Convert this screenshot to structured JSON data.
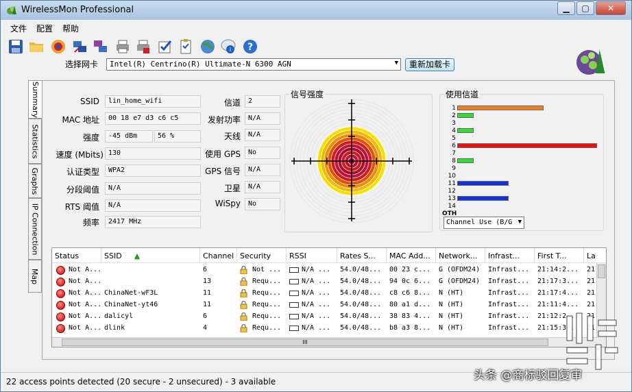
{
  "window": {
    "title": "WirelessMon Professional",
    "min": "▁",
    "max": "▢",
    "close": "✕"
  },
  "menu": [
    "文件",
    "配置",
    "帮助"
  ],
  "toolbar_icons": [
    "save-icon",
    "open-folder-icon",
    "record-icon",
    "network-adapter-icon",
    "network-adapters-icon",
    "printer-icon",
    "print-red-icon",
    "checklist-icon",
    "clipboard-icon",
    "globe-icon",
    "info-chat-icon",
    "help-icon"
  ],
  "nic": {
    "label": "选择网卡",
    "value": "Intel(R) Centrino(R) Ultimate-N 6300 AGN",
    "reload_label": "重新加载卡"
  },
  "tabs": [
    "Summary",
    "Statistics",
    "Graphs",
    "IP Connection",
    "Map"
  ],
  "summary": {
    "left": [
      {
        "label": "SSID",
        "value": "lin_home_wifi"
      },
      {
        "label": "MAC 地址",
        "value": "00 18 e7 d3 c6 c5"
      },
      {
        "label": "强度",
        "value": "-45 dBm",
        "value2": "56 %"
      },
      {
        "label": "速度 (Mbits)",
        "value": "130"
      },
      {
        "label": "认证类型",
        "value": "WPA2"
      },
      {
        "label": "分段阈值",
        "value": "N/A"
      },
      {
        "label": "RTS 阈值",
        "value": "N/A"
      },
      {
        "label": "频率",
        "value": "2417 MHz"
      }
    ],
    "right": [
      {
        "label": "信道",
        "value": "2"
      },
      {
        "label": "发射功率",
        "value": "N/A"
      },
      {
        "label": "天线",
        "value": "N/A"
      },
      {
        "label": "使用 GPS",
        "value": "No"
      },
      {
        "label": "GPS 信号",
        "value": "N/A"
      },
      {
        "label": "卫星",
        "value": "N/A"
      },
      {
        "label": "WiSpy",
        "value": "No"
      }
    ]
  },
  "signal_title": "信号强度",
  "signal_percent": 56,
  "channels": {
    "title": "使用信道",
    "labels": [
      "1",
      "2",
      "3",
      "4",
      "5",
      "6",
      "7",
      "8",
      "9",
      "10",
      "11",
      "12",
      "13",
      "14",
      "OTH"
    ],
    "usage": [
      0.62,
      0.12,
      0,
      0.12,
      0,
      1.0,
      0,
      0.12,
      0,
      0,
      0.37,
      0,
      0.37,
      0,
      0
    ],
    "colors": [
      "#f08020",
      "#30e030",
      "",
      "#30e030",
      "",
      "#ee1010",
      "",
      "#30e030",
      "",
      "",
      "#1030e0",
      "",
      "#1030e0",
      "",
      ""
    ],
    "select_value": "Channel Use (B/G"
  },
  "list": {
    "columns": [
      "Status",
      "SSID",
      "Channel",
      "Security",
      "RSSI",
      "Rates S...",
      "MAC Add...",
      "Network...",
      "Infrast...",
      "First T...",
      "La"
    ],
    "rows": [
      [
        "Not A...",
        "",
        "6",
        "Not ...",
        "N/A ...",
        "54.0/48...",
        "00 23 c...",
        "G (OFDM24)",
        "Infrast...",
        "21:14:2...",
        "21"
      ],
      [
        "Not A...",
        "",
        "13",
        "Requ...",
        "N/A ...",
        "54.0/48...",
        "94 0c 6...",
        "G (OFDM24)",
        "Infrast...",
        "21:17:3...",
        "21"
      ],
      [
        "Not A...",
        "ChinaNet-wF3L",
        "11",
        "Requ...",
        "N/A ...",
        "54.0/48...",
        "c8 c6 8...",
        "N (HT)",
        "Infrast...",
        "21:17:4...",
        "21"
      ],
      [
        "Not A...",
        "ChinaNet-yt46",
        "11",
        "Requ...",
        "N/A ...",
        "54.0/48...",
        "80 a1 d...",
        "N (HT)",
        "Infrast...",
        "21:11:4...",
        "21"
      ],
      [
        "Not A...",
        "dalicyl",
        "6",
        "Requ...",
        "N/A ...",
        "54.0/48...",
        "38 83 4...",
        "N (HT)",
        "Infrast...",
        "21:12:2...",
        "21"
      ],
      [
        "Not A...",
        "dlink",
        "4",
        "Requ...",
        "N/A ...",
        "54.0/48...",
        "b8 a3 8...",
        "N (HT)",
        "Infrast...",
        "21:15:3...",
        "21"
      ]
    ],
    "scroll_grip": "III"
  },
  "status": "22 access points detected (20 secure - 2 unsecured) - 3 available",
  "watermark": "头条 @商标驳回复审"
}
